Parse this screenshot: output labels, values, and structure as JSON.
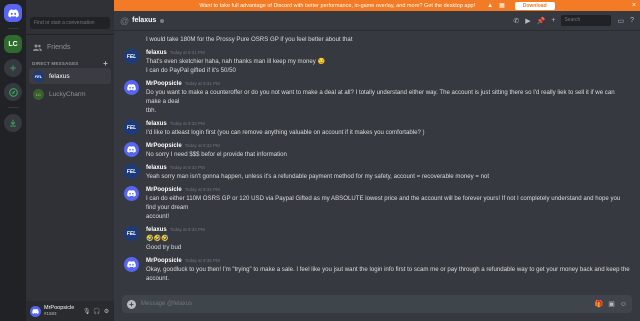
{
  "banner": {
    "text": "Want to take full advantage of Discord with better performance, in-game overlay, and more? Get the desktop app!",
    "download_label": "Download"
  },
  "rail": {
    "server_label": "LC"
  },
  "sidebar": {
    "search_placeholder": "Find or start a conversation",
    "friends_label": "Friends",
    "dm_header": "DIRECT MESSAGES",
    "dms": [
      {
        "name": "felaxus",
        "avatar": "FEL"
      },
      {
        "name": "LuckyCharm",
        "avatar": "LC"
      }
    ],
    "user": {
      "name": "MrPoopsicle",
      "tag": "#1583"
    }
  },
  "header": {
    "title": "felaxus",
    "search_placeholder": "Search"
  },
  "messages": [
    {
      "type": "cont",
      "lines": [
        "I would take 180M for the Prossy Pure OSRS GP if you feel better about that"
      ]
    },
    {
      "type": "full",
      "author": "felaxus",
      "avatar": "fel",
      "ts": "Today at 9:31 PM",
      "lines": [
        "That's even sketchier haha, nah thanks man ill keep my money 😏",
        "I can do PayPal gifted if it's 50/50"
      ]
    },
    {
      "type": "full",
      "author": "MrPoopsicle",
      "avatar": "mr",
      "ts": "Today at 9:31 PM",
      "lines": [
        "Do you want to make a counteroffer or do you not want to make a deal at all? I totally understand either way. The account is just sitting there so I'd really liek to sell it if we can make a deal",
        "tbh."
      ]
    },
    {
      "type": "full",
      "author": "felaxus",
      "avatar": "fel",
      "ts": "Today at 9:32 PM",
      "lines": [
        "I'd like to atleast login first (you can remove anything valuable on account if it makes you comfortable? )"
      ]
    },
    {
      "type": "full",
      "author": "MrPoopsicle",
      "avatar": "mr",
      "ts": "Today at 9:32 PM",
      "lines": [
        "No sorry I need $$$ befor el provide that information"
      ]
    },
    {
      "type": "full",
      "author": "felaxus",
      "avatar": "fel",
      "ts": "Today at 9:33 PM",
      "lines": [
        "Yeah sorry man isn't gonna happen, unless it's a refundable payment method for my safety, account = recoverable money = not"
      ]
    },
    {
      "type": "full",
      "author": "MrPoopsicle",
      "avatar": "mr",
      "ts": "Today at 9:34 PM",
      "lines": [
        "I can do either 110M OSRS GP or 120 USD via Paypal Gifted as my ABSOLUTE lowest price and the account will be forever yours! If not I completely understand and hope you find your dream",
        "account!"
      ]
    },
    {
      "type": "full",
      "author": "felaxus",
      "avatar": "fel",
      "ts": "Today at 9:34 PM",
      "lines": [
        "🤣🤣🤣",
        "Good try bud"
      ],
      "emoji_first": true
    },
    {
      "type": "full",
      "author": "MrPoopsicle",
      "avatar": "mr",
      "ts": "Today at 9:35 PM",
      "lines": [
        "Okay, goodluck to you then! I'm \"trying\" to make a sale. I feel like you jsut want the login info first to scam me or pay through a refundable way to get your money back and keep the account."
      ]
    }
  ],
  "composer": {
    "placeholder": "Message @felaxus"
  },
  "colors": {
    "blurple": "#5865f2",
    "banner": "#f47b25",
    "bg": "#36393f"
  }
}
